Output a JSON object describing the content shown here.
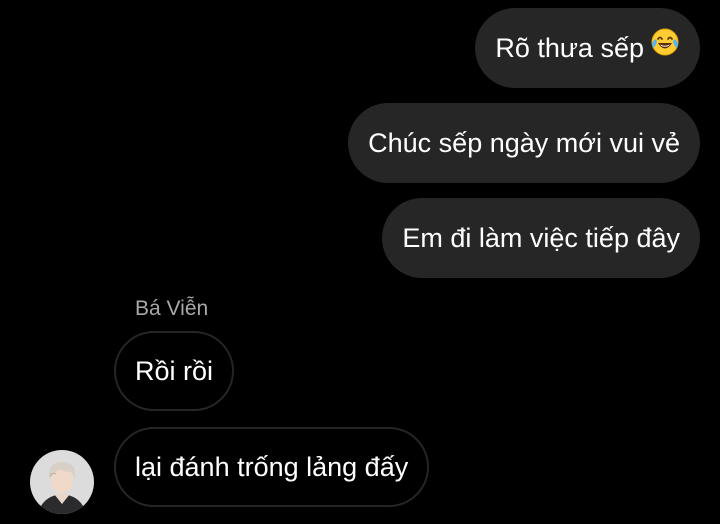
{
  "thread": {
    "outgoing": [
      {
        "text": "Rõ thưa sếp",
        "emoji": "face-with-tears-of-joy"
      },
      {
        "text": "Chúc sếp ngày mới vui vẻ"
      },
      {
        "text": "Em đi làm việc tiếp đây"
      }
    ],
    "sender_name": "Bá Viễn",
    "incoming": [
      {
        "text": "Rồi rồi"
      },
      {
        "text": "lại đánh trống lảng đấy"
      }
    ]
  },
  "colors": {
    "background": "#000000",
    "outgoing_bubble": "#262626",
    "incoming_border": "#262626",
    "text": "#ffffff",
    "sender_name": "#a8a8a8"
  }
}
